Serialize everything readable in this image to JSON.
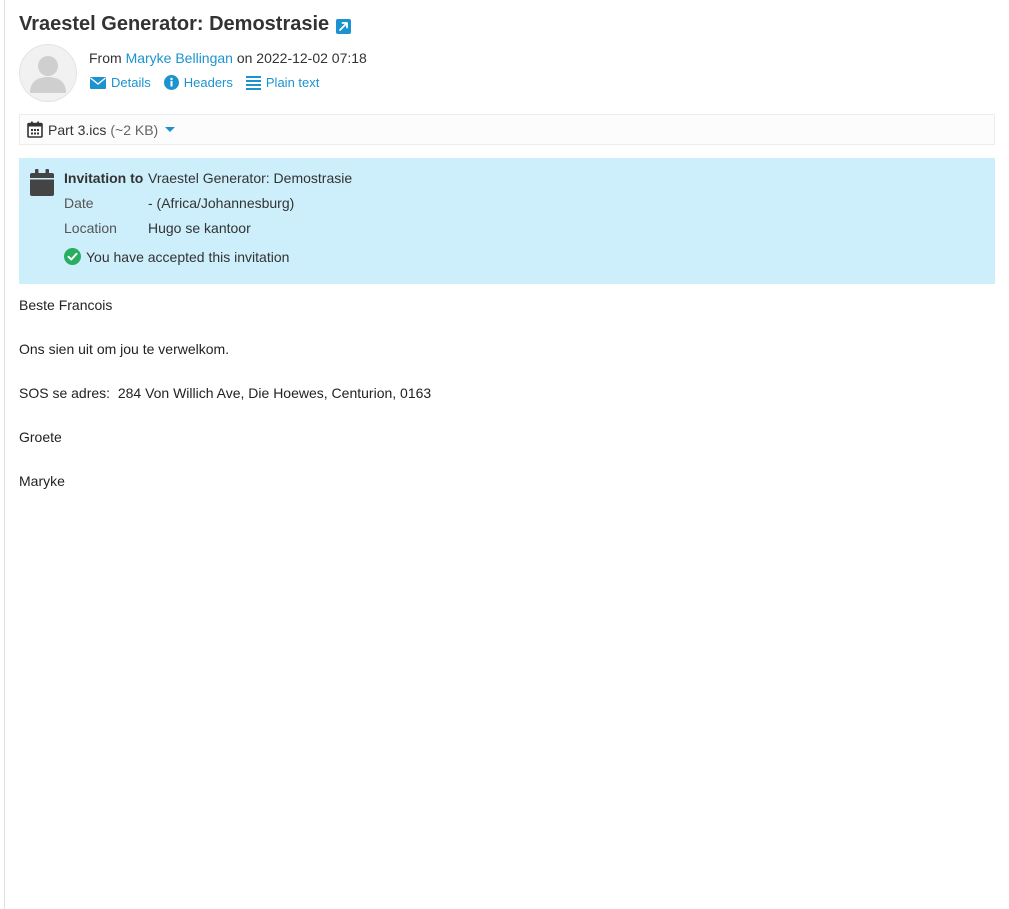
{
  "message": {
    "subject": "Vraestel Generator: Demostrasie",
    "from_prefix": "From",
    "sender": "Maryke Bellingan",
    "date_text": "on 2022-12-02 07:18",
    "actions": {
      "details": "Details",
      "headers": "Headers",
      "plain_text": "Plain text"
    }
  },
  "attachment": {
    "name": "Part 3.ics",
    "size": "(~2 KB)"
  },
  "invitation": {
    "title_label": "Invitation to",
    "title_value": "Vraestel Generator: Demostrasie",
    "date_label": "Date",
    "date_value": "- (Africa/Johannesburg)",
    "location_label": "Location",
    "location_value": "Hugo se kantoor",
    "status": "You have accepted this invitation"
  },
  "body": {
    "greeting": "Beste Francois",
    "line1": "Ons sien uit om jou te verwelkom.",
    "line2": "SOS se adres:  284 Von Willich Ave, Die Hoewes, Centurion, 0163",
    "closing": "Groete",
    "signature": "Maryke"
  },
  "colors": {
    "link": "#1c93cf",
    "invite_bg": "#cdeefb",
    "accepted_green": "#27ae60"
  }
}
